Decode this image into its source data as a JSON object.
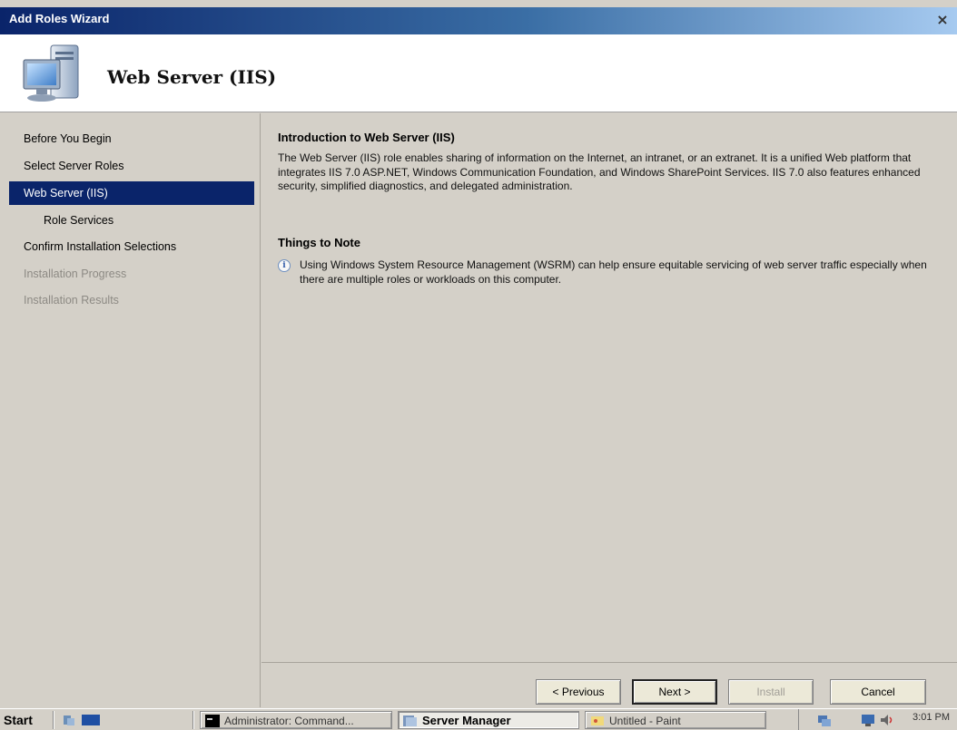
{
  "window": {
    "title": "Add Roles Wizard",
    "close_symbol": "×"
  },
  "header": {
    "title": "Web Server (IIS)",
    "icon": "server-monitor-icon"
  },
  "nav": {
    "items": [
      {
        "label": "Before You Begin",
        "state": "normal"
      },
      {
        "label": "Select Server Roles",
        "state": "normal"
      },
      {
        "label": "Web Server (IIS)",
        "state": "active"
      },
      {
        "label": "Role Services",
        "state": "sub"
      },
      {
        "label": "Confirm Installation Selections",
        "state": "normal"
      },
      {
        "label": "Installation Progress",
        "state": "disabled"
      },
      {
        "label": "Installation Results",
        "state": "disabled"
      }
    ],
    "active_color": "#0a246a"
  },
  "content": {
    "intro_heading": "Introduction to Web Server (IIS)",
    "intro_text": "The Web Server (IIS) role enables sharing of information on the Internet, an intranet, or an extranet. It is a unified Web platform that integrates IIS 7.0 ASP.NET, Windows Communication Foundation, and Windows SharePoint Services. IIS 7.0 also features enhanced security, simplified diagnostics, and delegated administration.",
    "note_heading": "Things to Note",
    "note_icon": "info-icon",
    "note_text": "Using Windows System Resource Management (WSRM) can help ensure equitable servicing of web server traffic especially when there are multiple roles or workloads on this computer."
  },
  "buttons": {
    "previous": "< Previous",
    "next": "Next >",
    "install": "Install",
    "cancel": "Cancel"
  },
  "taskbar": {
    "start_label": "Start",
    "items": [
      {
        "label": "Administrator: Command...",
        "icon": "command-prompt-icon"
      },
      {
        "label": "Server Manager",
        "icon": "server-manager-icon",
        "active": true
      },
      {
        "label": "Untitled - Paint",
        "icon": "paint-icon"
      }
    ],
    "clock": "3:01 PM"
  }
}
